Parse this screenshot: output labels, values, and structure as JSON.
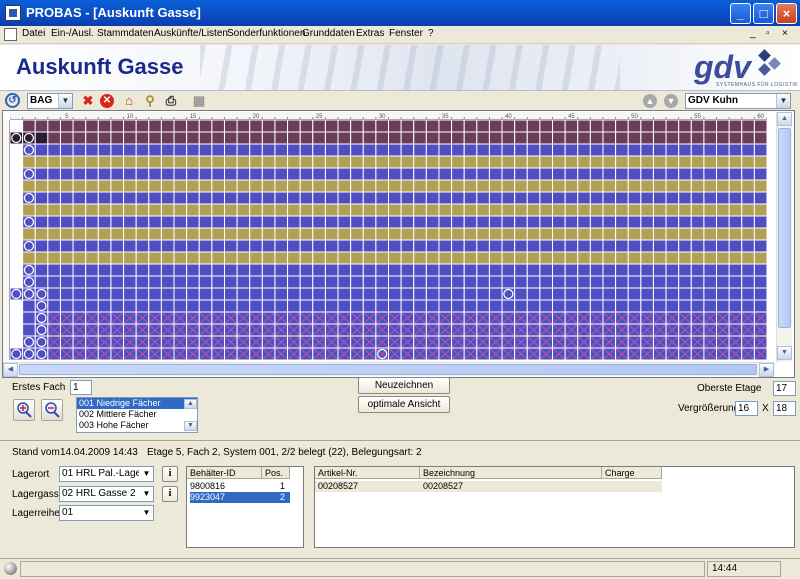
{
  "window": {
    "title": "PROBAS - [Auskunft Gasse]"
  },
  "menu": {
    "items": [
      "Datei",
      "Ein-/Ausl.",
      "Stammdaten",
      "Auskünfte/Listen",
      "Sonderfunktionen",
      "Grunddaten",
      "Extras",
      "Fenster",
      "?"
    ]
  },
  "banner": {
    "heading": "Auskunft Gasse",
    "logo": "gdv",
    "logo_sub": "SYSTEMHAUS FÜR LOGISTIK"
  },
  "toolbar": {
    "combo_value": "BAG",
    "user_combo_value": "GDV Kuhn"
  },
  "grid": {
    "columns": 60,
    "rows": 20,
    "ruler_labels": [
      "5",
      "10",
      "15",
      "20",
      "25",
      "30",
      "35",
      "40",
      "45",
      "50",
      "55",
      "60"
    ],
    "colors": {
      "purple": "#6c3d5b",
      "blue": "#4f4fc3",
      "olive": "#b2a055",
      "xmark": "#c0549a",
      "dark": "#2a1a33"
    },
    "row_types": [
      "purple",
      "purple",
      "blue",
      "olive",
      "blue",
      "olive",
      "blue",
      "olive",
      "blue",
      "olive",
      "blue",
      "olive",
      "blue",
      "blue",
      "blue",
      "blue",
      "x",
      "x",
      "x",
      "x"
    ]
  },
  "controls": {
    "first_fach_label": "Erstes Fach",
    "first_fach_value": "1",
    "redraw_button": "Neuzeichnen",
    "optimal_button": "optimale Ansicht",
    "top_level_label": "Oberste Etage",
    "top_level_value": "17",
    "zoom_label": "Vergrößerung",
    "zoom_x": "16",
    "zoom_sep": "X",
    "zoom_y": "18",
    "fach_types": [
      "001 Niedrige Fächer",
      "002 Mittlere Fächer",
      "003 Hohe Fächer"
    ]
  },
  "info": {
    "stand_label": "Stand vom",
    "stand_value": "14.04.2009 14:43",
    "status_text": "Etage 5, Fach 2, System 001, 2/2 belegt (22), Belegungsart: 2"
  },
  "location": {
    "lagerort_label": "Lagerort",
    "lagerort_value": "01 HRL Pal.-Lager",
    "lagergasse_label": "Lagergasse",
    "lagergasse_value": "02 HRL Gasse 2",
    "lagerreihe_label": "Lagerreihe",
    "lagerreihe_value": "01",
    "info_button": "i"
  },
  "containers": {
    "headers": [
      "Behälter-ID",
      "Pos."
    ],
    "rows": [
      {
        "id": "9800816",
        "pos": "1",
        "selected": false
      },
      {
        "id": "9923047",
        "pos": "2",
        "selected": true
      }
    ]
  },
  "articles": {
    "headers": [
      "Artikel-Nr.",
      "Bezeichnung",
      "Charge"
    ],
    "rows": [
      {
        "nr": "00208527",
        "bez": "00208527",
        "charge": ""
      }
    ]
  },
  "statusbar": {
    "time": "14:44"
  }
}
